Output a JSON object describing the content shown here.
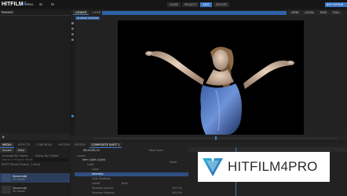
{
  "app": {
    "logo_hit": "HITFILM",
    "logo_4": "4",
    "logo_pro": "PRO",
    "brand_color": "#3a78c4"
  },
  "top_nav": {
    "tabs": [
      "HOME",
      "PROJECT",
      "EDIT",
      "EXPORT"
    ],
    "active_index": 2,
    "right_link": "BUY HITFILM"
  },
  "left_panel": {
    "title": "TRIMMER"
  },
  "viewer": {
    "tabs": [
      "VIEWER",
      "LAYER"
    ],
    "active_tab": "VIEWER",
    "breadcrumb": "Andrew Camera",
    "controls": [
      "VIEW",
      "LOCAL",
      "RGB",
      "FULL"
    ]
  },
  "media_panel": {
    "tabs": [
      "MEDIA",
      "EFFECTS",
      "CONTROLS",
      "HISTORY"
    ],
    "import_label": "Import",
    "new_label": "New",
    "arrange_label": "Arrange By: Name",
    "group_label": "Group By: Folder",
    "search_placeholder": "Search in Project Media",
    "folder_label": "ROOT (Entire Project, 1 Item)",
    "items": [
      {
        "name": "Dancer.obj",
        "sub": "3D Model"
      },
      {
        "name": "Dancer.obj",
        "sub": "3D Model"
      }
    ]
  },
  "editor": {
    "tabs": [
      "EDITOR",
      "COMPOSITE SHOT 1"
    ],
    "timecode": "00;00;09;13",
    "new_layer": "New Layer",
    "mode_label": "Mode",
    "layers_header": "Layers",
    "rows": [
      "Item Light (Light)",
      "Light",
      "Color",
      "Intensity",
      "Cast Shadows",
      "Falloff",
      "Shadow Opacity",
      "Shadow Softness"
    ],
    "right_values": [
      "Both",
      "100.0%",
      "100.0%"
    ]
  },
  "watermark": {
    "text": "HITFILM4PRO"
  }
}
